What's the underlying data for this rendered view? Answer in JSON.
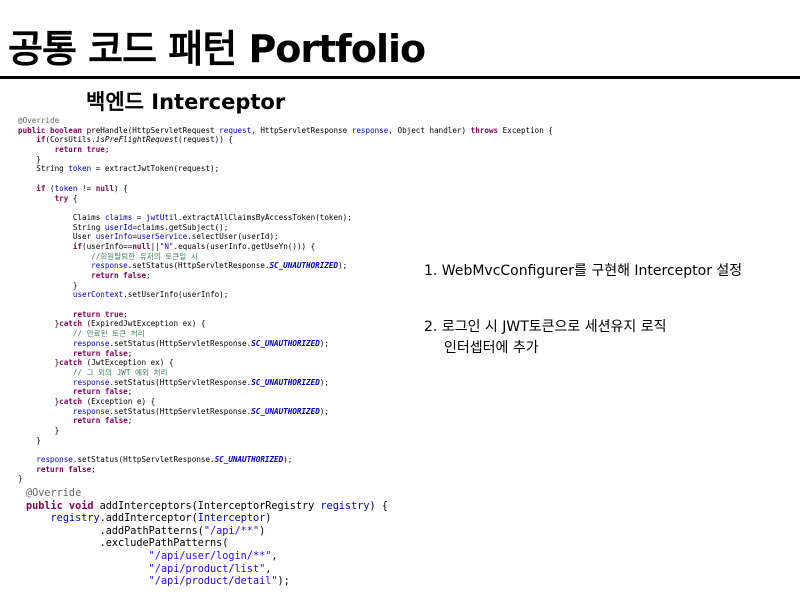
{
  "slide": {
    "title": "공통 코드 패턴 Portfolio",
    "subtitle": "백엔드 Interceptor"
  },
  "code_prehandle": [
    [
      [
        "ann",
        "@Override"
      ]
    ],
    [
      [
        "kw",
        "public boolean "
      ],
      [
        "",
        "preHandle(HttpServletRequest "
      ],
      [
        "var",
        "request"
      ],
      [
        "",
        ", HttpServletResponse "
      ],
      [
        "var",
        "response"
      ],
      [
        "",
        ", Object handler) "
      ],
      [
        "kw",
        "throws "
      ],
      [
        "",
        "Exception {"
      ]
    ],
    [
      [
        "",
        "    "
      ],
      [
        "kw",
        "if"
      ],
      [
        "",
        "(CorsUtils."
      ],
      [
        "itl",
        "isPreFlightRequest"
      ],
      [
        "",
        "(request)) {"
      ]
    ],
    [
      [
        "",
        "        "
      ],
      [
        "kw",
        "return true"
      ],
      [
        "",
        ";"
      ]
    ],
    [
      [
        "",
        "    }"
      ]
    ],
    [
      [
        "",
        "    String "
      ],
      [
        "var",
        "token"
      ],
      [
        "",
        " = extractJwtToken(request);"
      ]
    ],
    [
      [
        "",
        ""
      ]
    ],
    [
      [
        "",
        "    "
      ],
      [
        "kw",
        "if "
      ],
      [
        "",
        "("
      ],
      [
        "var",
        "token"
      ],
      [
        "",
        " != "
      ],
      [
        "kw",
        "null"
      ],
      [
        "",
        ") {"
      ]
    ],
    [
      [
        "",
        "        "
      ],
      [
        "kw",
        "try "
      ],
      [
        "",
        "{"
      ]
    ],
    [
      [
        "",
        ""
      ]
    ],
    [
      [
        "",
        "            Claims "
      ],
      [
        "var",
        "claims"
      ],
      [
        "",
        " = "
      ],
      [
        "var",
        "jwtUtil"
      ],
      [
        "",
        ".extractAllClaimsByAccessToken(token);"
      ]
    ],
    [
      [
        "",
        "            String "
      ],
      [
        "var",
        "userId"
      ],
      [
        "",
        "=claims.getSubject();"
      ]
    ],
    [
      [
        "",
        "            User "
      ],
      [
        "var",
        "userInfo"
      ],
      [
        "",
        "="
      ],
      [
        "var",
        "userService"
      ],
      [
        "",
        ".selectUser(userId);"
      ]
    ],
    [
      [
        "",
        "            "
      ],
      [
        "kw",
        "if"
      ],
      [
        "",
        "(userInfo=="
      ],
      [
        "kw",
        "null"
      ],
      [
        "",
        "||"
      ],
      [
        "str",
        "\"N\""
      ],
      [
        "",
        ".equals(userInfo.getUseYn())) {"
      ]
    ],
    [
      [
        "",
        "                "
      ],
      [
        "cmt",
        "//회원탈퇴한 유저의 토큰일 시"
      ]
    ],
    [
      [
        "",
        "                "
      ],
      [
        "var",
        "response"
      ],
      [
        "",
        ".setStatus(HttpServletResponse."
      ],
      [
        "cst",
        "SC_UNAUTHORIZED"
      ],
      [
        "",
        ");"
      ]
    ],
    [
      [
        "",
        "                "
      ],
      [
        "kw",
        "return false"
      ],
      [
        "",
        ";"
      ]
    ],
    [
      [
        "",
        "            }"
      ]
    ],
    [
      [
        "",
        "            "
      ],
      [
        "var",
        "userContext"
      ],
      [
        "",
        ".setUserInfo(userInfo);"
      ]
    ],
    [
      [
        "",
        ""
      ]
    ],
    [
      [
        "",
        "            "
      ],
      [
        "kw",
        "return true"
      ],
      [
        "",
        ";"
      ]
    ],
    [
      [
        "",
        "        }"
      ],
      [
        "kw",
        "catch "
      ],
      [
        "",
        "(ExpiredJwtException ex) {"
      ]
    ],
    [
      [
        "",
        "            "
      ],
      [
        "cmt",
        "// 만료된 토큰 처리"
      ]
    ],
    [
      [
        "",
        "            "
      ],
      [
        "var",
        "response"
      ],
      [
        "",
        ".setStatus(HttpServletResponse."
      ],
      [
        "cst",
        "SC_UNAUTHORIZED"
      ],
      [
        "",
        ");"
      ]
    ],
    [
      [
        "",
        "            "
      ],
      [
        "kw",
        "return false"
      ],
      [
        "",
        ";"
      ]
    ],
    [
      [
        "",
        "        }"
      ],
      [
        "kw",
        "catch "
      ],
      [
        "",
        "(JwtException ex) {"
      ]
    ],
    [
      [
        "",
        "            "
      ],
      [
        "cmt",
        "// 그 외의 JWT 예외 처리"
      ]
    ],
    [
      [
        "",
        "            "
      ],
      [
        "var",
        "response"
      ],
      [
        "",
        ".setStatus(HttpServletResponse."
      ],
      [
        "cst",
        "SC_UNAUTHORIZED"
      ],
      [
        "",
        ");"
      ]
    ],
    [
      [
        "",
        "            "
      ],
      [
        "kw",
        "return false"
      ],
      [
        "",
        ";"
      ]
    ],
    [
      [
        "",
        "        }"
      ],
      [
        "kw",
        "catch "
      ],
      [
        "",
        "(Exception e) {"
      ]
    ],
    [
      [
        "",
        "            "
      ],
      [
        "var",
        "response"
      ],
      [
        "",
        ".setStatus(HttpServletResponse."
      ],
      [
        "cst",
        "SC_UNAUTHORIZED"
      ],
      [
        "",
        ");"
      ]
    ],
    [
      [
        "",
        "            "
      ],
      [
        "kw",
        "return false"
      ],
      [
        "",
        ";"
      ]
    ],
    [
      [
        "",
        "        }"
      ]
    ],
    [
      [
        "",
        "    }"
      ]
    ],
    [
      [
        "",
        ""
      ]
    ],
    [
      [
        "",
        "    "
      ],
      [
        "var",
        "response"
      ],
      [
        "",
        ".setStatus(HttpServletResponse."
      ],
      [
        "cst",
        "SC_UNAUTHORIZED"
      ],
      [
        "",
        ");"
      ]
    ],
    [
      [
        "",
        "    "
      ],
      [
        "kw",
        "return false"
      ],
      [
        "",
        ";"
      ]
    ],
    [
      [
        "",
        "}"
      ]
    ]
  ],
  "code_interceptors": [
    [
      [
        "ann",
        "@Override"
      ]
    ],
    [
      [
        "kw",
        "public void "
      ],
      [
        "",
        "addInterceptors(InterceptorRegistry "
      ],
      [
        "var",
        "registry"
      ],
      [
        "",
        ") {"
      ]
    ],
    [
      [
        "",
        "    "
      ],
      [
        "var",
        "registry"
      ],
      [
        "",
        ".addInterceptor("
      ],
      [
        "var",
        "Interceptor"
      ],
      [
        "",
        ")"
      ]
    ],
    [
      [
        "",
        "            .addPathPatterns("
      ],
      [
        "str",
        "\"/api/**\""
      ],
      [
        "",
        ")"
      ]
    ],
    [
      [
        "",
        "            .excludePathPatterns("
      ]
    ],
    [
      [
        "",
        "                    "
      ],
      [
        "str",
        "\"/api/user/login/**\""
      ],
      [
        "",
        ","
      ]
    ],
    [
      [
        "",
        "                    "
      ],
      [
        "str",
        "\"/api/product/list\""
      ],
      [
        "",
        ","
      ]
    ],
    [
      [
        "",
        "                    "
      ],
      [
        "str",
        "\"/api/product/detail\""
      ],
      [
        "",
        ");"
      ]
    ]
  ],
  "notes": {
    "item1": "1. WebMvcConfigurer를 구현해 Interceptor 설정",
    "item2_line1": "2. 로그인 시 JWT토큰으로 세션유지 로직",
    "item2_line2": "인터셉터에 추가"
  }
}
